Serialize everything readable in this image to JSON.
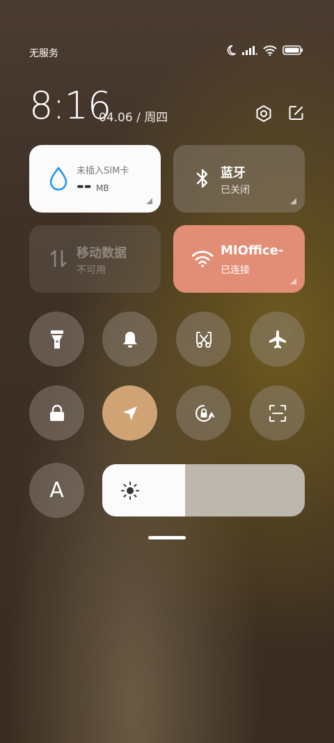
{
  "status_bar": {
    "carrier": "无服务",
    "icons": [
      "moon-icon",
      "signal-icon",
      "wifi-icon",
      "battery-icon"
    ]
  },
  "header": {
    "time": "8:16",
    "date": "04.06 / 周四",
    "actions": [
      "settings-icon",
      "edit-icon"
    ]
  },
  "tiles": {
    "data": {
      "title": "未插入SIM卡",
      "value": "--",
      "unit": "MB",
      "icon": "water-drop-icon"
    },
    "bluetooth": {
      "title": "蓝牙",
      "status": "已关闭",
      "icon": "bluetooth-icon"
    },
    "mobile_data": {
      "title": "移动数据",
      "status": "不可用",
      "icon": "data-arrows-icon"
    },
    "wifi": {
      "title": "MIOffice-",
      "status": "已连接",
      "icon": "wifi-icon"
    }
  },
  "toggles": [
    {
      "name": "flashlight",
      "icon": "flashlight-icon",
      "active": false
    },
    {
      "name": "ring",
      "icon": "bell-icon",
      "active": false
    },
    {
      "name": "screenshot",
      "icon": "scissors-icon",
      "active": false
    },
    {
      "name": "airplane",
      "icon": "airplane-icon",
      "active": false
    },
    {
      "name": "lock",
      "icon": "lock-icon",
      "active": false
    },
    {
      "name": "location",
      "icon": "location-arrow-icon",
      "active": true
    },
    {
      "name": "rotation-lock",
      "icon": "rotation-lock-icon",
      "active": false
    },
    {
      "name": "scanner",
      "icon": "scan-icon",
      "active": false
    },
    {
      "name": "auto-brightness",
      "icon": "letter-a-icon",
      "active": false
    }
  ],
  "auto_brightness_label": "A",
  "brightness": {
    "level": 0.41,
    "icon": "sun-icon"
  },
  "colors": {
    "accent_wifi": "#e28d76",
    "accent_location": "#d0a375",
    "data_icon": "#2196f3"
  }
}
